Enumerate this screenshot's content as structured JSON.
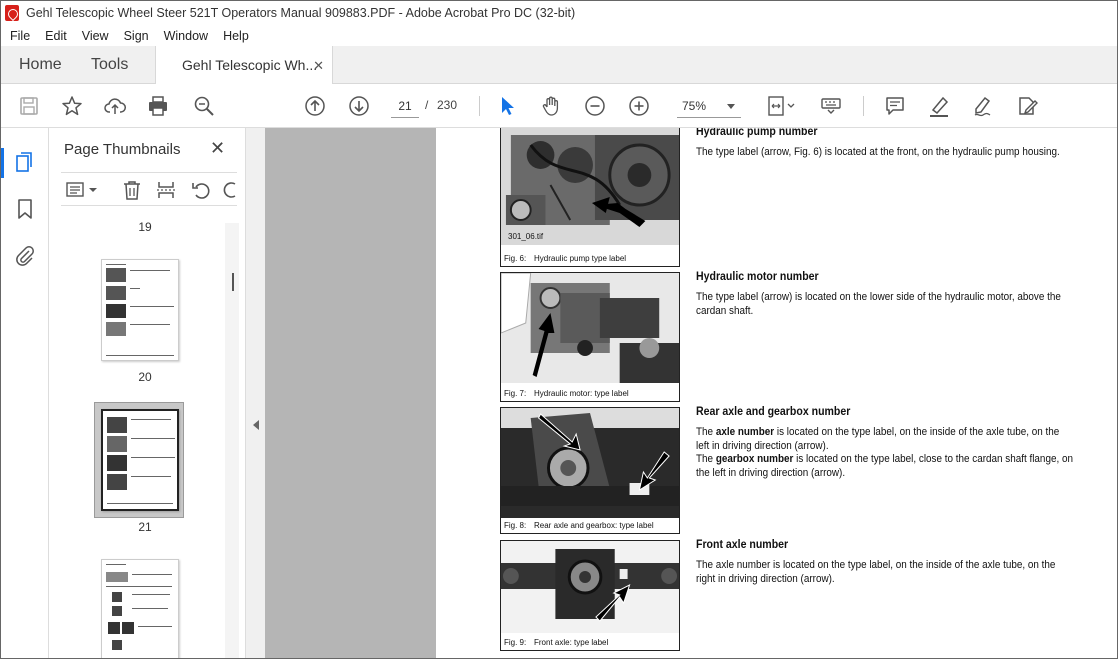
{
  "window": {
    "title": "Gehl Telescopic Wheel Steer 521T Operators Manual 909883.PDF - Adobe Acrobat Pro DC (32-bit)"
  },
  "menu": [
    "File",
    "Edit",
    "View",
    "Sign",
    "Window",
    "Help"
  ],
  "tabs": {
    "home": "Home",
    "tools": "Tools",
    "document": "Gehl Telescopic Wh...",
    "close_glyph": "✕"
  },
  "toolbar": {
    "current_page": "21",
    "page_separator": "/",
    "total_pages": "230",
    "zoom": "75%"
  },
  "thumbnails": {
    "title": "Page Thumbnails",
    "close_glyph": "✕",
    "pages": [
      {
        "label": "19"
      },
      {
        "label": "20"
      },
      {
        "label": "21"
      },
      {
        "label": ""
      }
    ]
  },
  "document": {
    "sections": [
      {
        "heading": "Hydraulic pump number",
        "body": "The type label (arrow, Fig. 6) is located at the front, on the hydraulic pump housing.",
        "figure_file": "301_06.tif",
        "figure_num": "Fig. 6:",
        "figure_caption": "Hydraulic pump type label"
      },
      {
        "heading": "Hydraulic motor number",
        "body": "The type label (arrow) is located on the lower side of the hydraulic motor, above the cardan shaft.",
        "figure_num": "Fig. 7:",
        "figure_caption": "Hydraulic motor: type label"
      },
      {
        "heading": "Rear axle and gearbox number",
        "body_parts": {
          "p1_pre": "The ",
          "p1_bold": "axle number",
          "p1_post": " is located on the type label, on the inside of the axle tube, on the left in driving direction (arrow).",
          "p2_pre": "The ",
          "p2_bold": "gearbox number",
          "p2_post": "  is located on the type label, close to the cardan shaft flange, on the left in driving direction (arrow)."
        },
        "figure_num": "Fig. 8:",
        "figure_caption": "Rear axle and gearbox: type label"
      },
      {
        "heading": "Front axle number",
        "body": "The axle number is located on the type label, on the inside of the axle tube, on the right in driving direction (arrow).",
        "figure_num": "Fig. 9:",
        "figure_caption": "Front axle: type label"
      }
    ]
  },
  "colors": {
    "accent": "#1473e6",
    "acrobat_red": "#d7201a",
    "canvas_gray": "#b5b5b5"
  }
}
